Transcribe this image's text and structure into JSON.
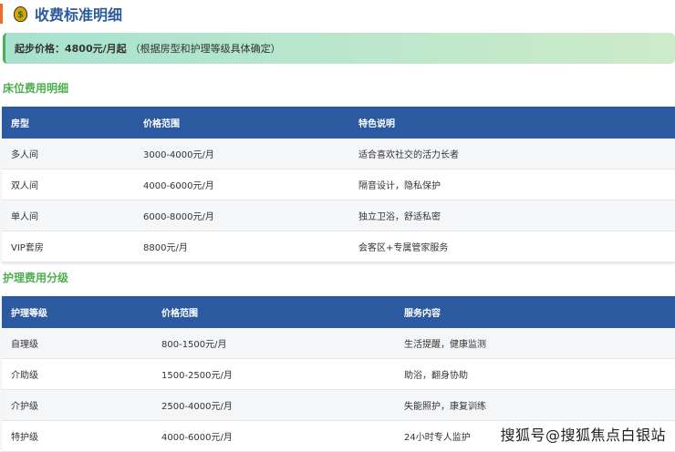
{
  "title": "收费标准明细",
  "title_icon": "money-bag-icon",
  "banner": {
    "label": "起步价格：4800元/月起",
    "note": "（根据房型和护理等级具体确定）"
  },
  "bed": {
    "heading": "床位费用明细",
    "headers": [
      "房型",
      "价格范围",
      "特色说明"
    ],
    "rows": [
      [
        "多人间",
        "3000-4000元/月",
        "适合喜欢社交的活力长者"
      ],
      [
        "双人间",
        "4000-6000元/月",
        "隔音设计，隐私保护"
      ],
      [
        "单人间",
        "6000-8000元/月",
        "独立卫浴，舒适私密"
      ],
      [
        "VIP套房",
        "8800元/月",
        "会客区+专属管家服务"
      ]
    ]
  },
  "care": {
    "heading": "护理费用分级",
    "headers": [
      "护理等级",
      "价格范围",
      "服务内容"
    ],
    "rows": [
      [
        "自理级",
        "800-1500元/月",
        "生活提醒，健康监测"
      ],
      [
        "介助级",
        "1500-2500元/月",
        "助浴，翻身协助"
      ],
      [
        "介护级",
        "2500-4000元/月",
        "失能照护，康复训练"
      ],
      [
        "特护级",
        "4000-6000元/月",
        "24小时专人监护"
      ]
    ]
  },
  "watermark": "搜狐号@搜狐焦点白银站",
  "colors": {
    "header": "#2b5aa0",
    "accent": "#4caf50",
    "title_bar": "#f06a2c"
  }
}
